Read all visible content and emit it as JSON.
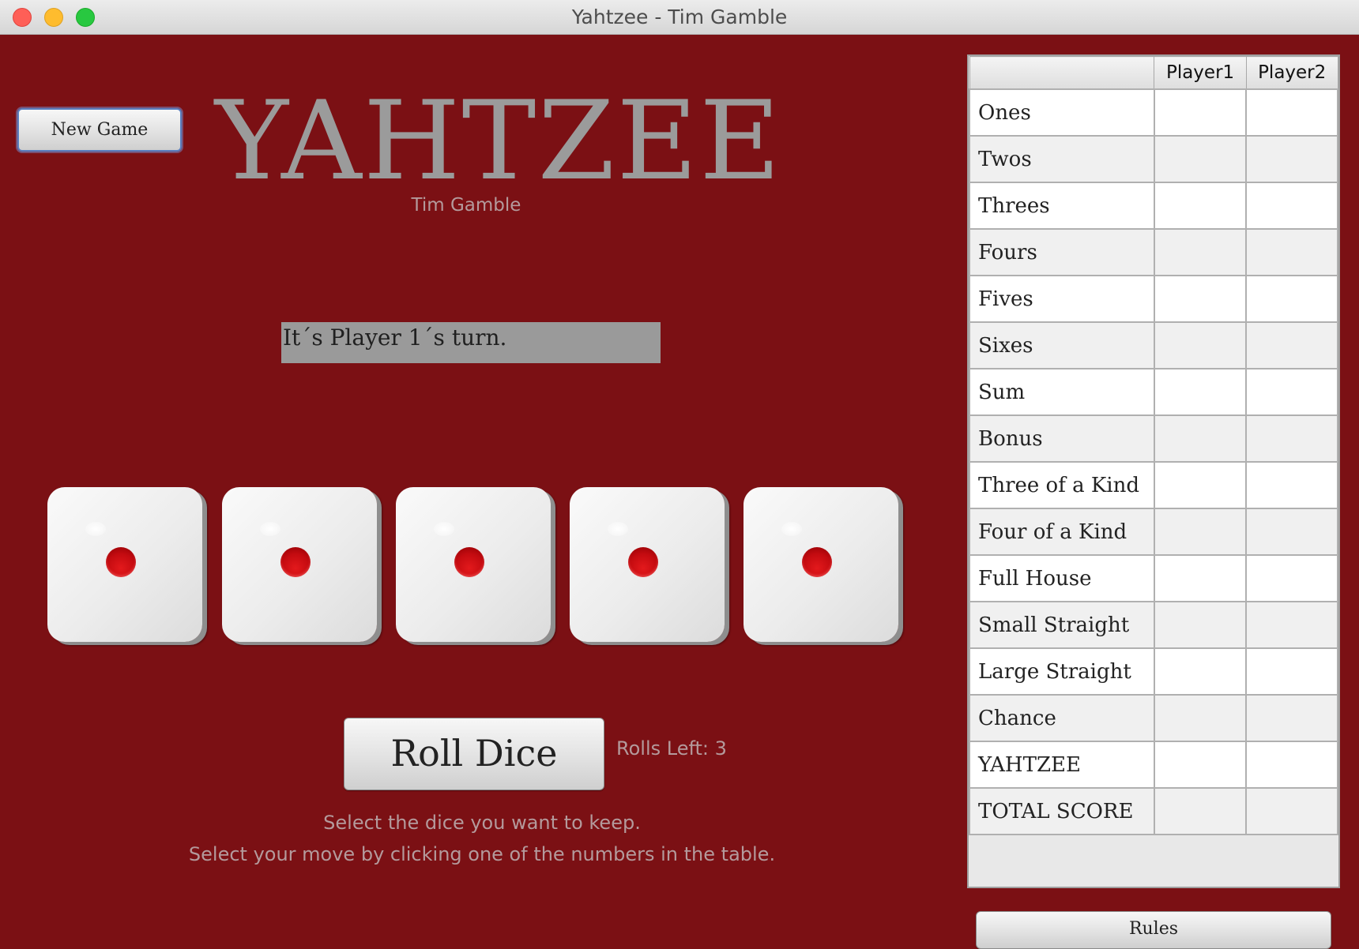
{
  "window": {
    "title": "Yahtzee - Tim Gamble"
  },
  "toolbar": {
    "new_game_label": "New Game"
  },
  "header": {
    "logo": "YAHTZEE",
    "author": "Tim Gamble"
  },
  "status": {
    "message": "It´s Player 1´s turn."
  },
  "dice": [
    {
      "value": 1
    },
    {
      "value": 1
    },
    {
      "value": 1
    },
    {
      "value": 1
    },
    {
      "value": 1
    }
  ],
  "controls": {
    "roll_label": "Roll Dice",
    "rolls_left": "Rolls Left: 3"
  },
  "help": {
    "line1": "Select the dice you want to keep.",
    "line2": "Select your move by clicking one of the numbers in the table."
  },
  "scorecard": {
    "columns": [
      "",
      "Player1",
      "Player2"
    ],
    "rows": [
      {
        "label": "Ones",
        "p1": "",
        "p2": ""
      },
      {
        "label": "Twos",
        "p1": "",
        "p2": ""
      },
      {
        "label": "Threes",
        "p1": "",
        "p2": ""
      },
      {
        "label": "Fours",
        "p1": "",
        "p2": ""
      },
      {
        "label": "Fives",
        "p1": "",
        "p2": ""
      },
      {
        "label": "Sixes",
        "p1": "",
        "p2": ""
      },
      {
        "label": "Sum",
        "p1": "",
        "p2": ""
      },
      {
        "label": "Bonus",
        "p1": "",
        "p2": ""
      },
      {
        "label": "Three of a Kind",
        "p1": "",
        "p2": ""
      },
      {
        "label": "Four of a Kind",
        "p1": "",
        "p2": ""
      },
      {
        "label": "Full House",
        "p1": "",
        "p2": ""
      },
      {
        "label": "Small Straight",
        "p1": "",
        "p2": ""
      },
      {
        "label": "Large Straight",
        "p1": "",
        "p2": ""
      },
      {
        "label": "Chance",
        "p1": "",
        "p2": ""
      },
      {
        "label": "YAHTZEE",
        "p1": "",
        "p2": ""
      },
      {
        "label": "TOTAL SCORE",
        "p1": "",
        "p2": ""
      }
    ]
  },
  "footer": {
    "rules_label": "Rules"
  },
  "colors": {
    "background": "#7b1014",
    "pip": "#c40b10",
    "muted_text": "#b49a9c"
  }
}
